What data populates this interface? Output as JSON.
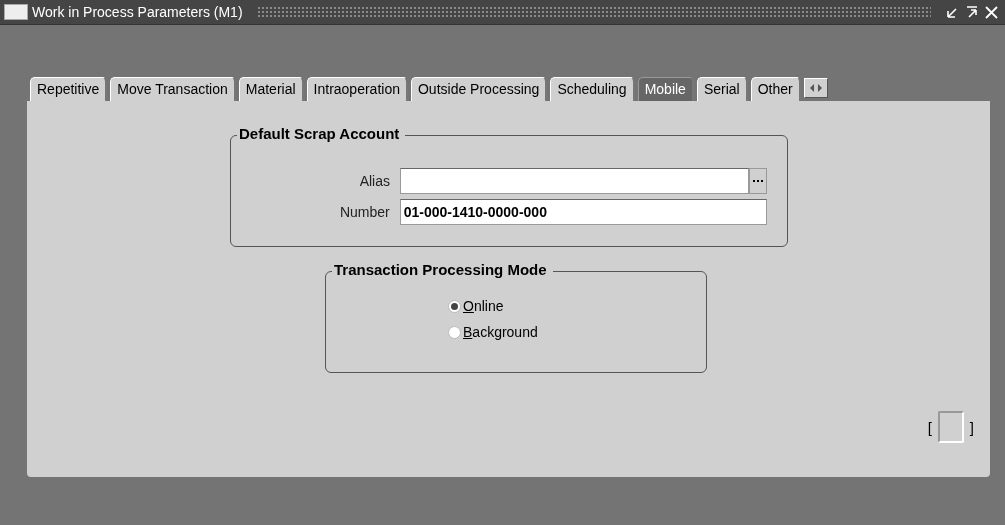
{
  "window": {
    "title": "Work in Process Parameters (M1)"
  },
  "tabs": [
    {
      "label": "Repetitive",
      "selected": false
    },
    {
      "label": "Move Transaction",
      "selected": false
    },
    {
      "label": "Material",
      "selected": false
    },
    {
      "label": "Intraoperation",
      "selected": false
    },
    {
      "label": "Outside Processing",
      "selected": false
    },
    {
      "label": "Scheduling",
      "selected": false
    },
    {
      "label": "Mobile",
      "selected": true
    },
    {
      "label": "Serial",
      "selected": false
    },
    {
      "label": "Other",
      "selected": false
    }
  ],
  "scrap_account": {
    "title": "Default Scrap Account",
    "alias": {
      "label": "Alias"
    },
    "number": {
      "label": "Number",
      "value": "01-000-1410-0000-000"
    }
  },
  "processing_mode": {
    "title": "Transaction Processing Mode",
    "options": [
      {
        "label": "Online",
        "selected": true
      },
      {
        "label": "Background",
        "selected": false
      }
    ]
  },
  "indicator": {
    "open": "[",
    "close": "]"
  }
}
